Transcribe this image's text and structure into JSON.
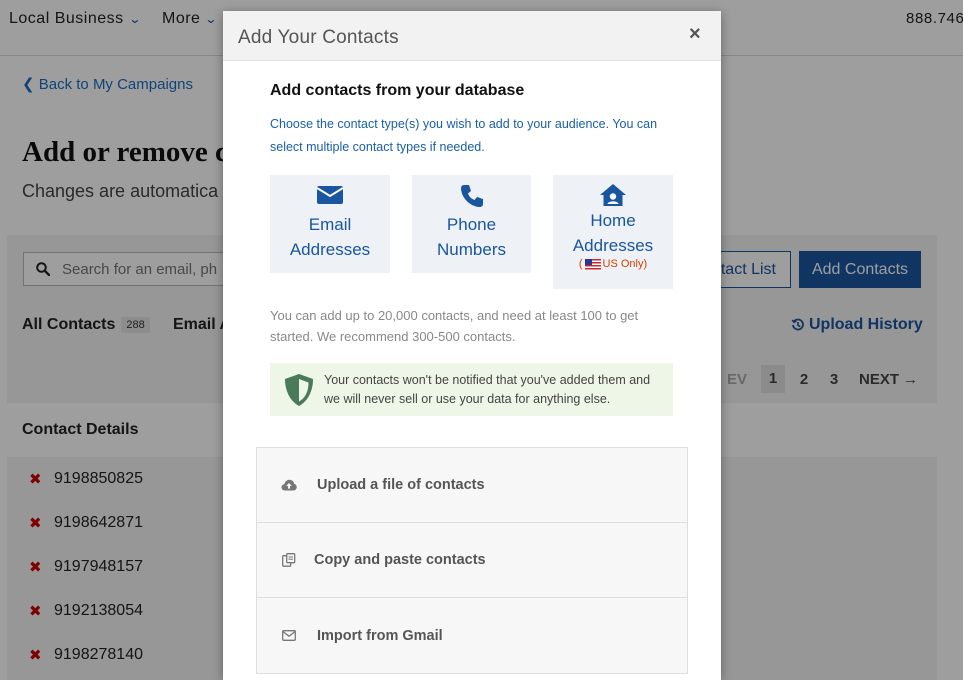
{
  "topnav": {
    "local_business": "Local Business",
    "more": "More",
    "phone": "888.746"
  },
  "page": {
    "back_link": "Back to My Campaigns",
    "title": "Add or remove c",
    "subtitle": "Changes are automatica"
  },
  "toolbar": {
    "search_placeholder": "Search for an email, ph",
    "contact_list_label": "tact List",
    "add_contacts_label": "Add Contacts",
    "filter_all_label": "All Contacts",
    "filter_all_count": "288",
    "filter_email_label": "Email A",
    "upload_history_label": "Upload History"
  },
  "pagination": {
    "prev_label": "EV",
    "pages": [
      "1",
      "2",
      "3"
    ],
    "current": "1",
    "next_label": "NEXT"
  },
  "contacts": {
    "header": "Contact Details",
    "rows": [
      "9198850825",
      "9198642871",
      "9197948157",
      "9192138054",
      "9198278140"
    ]
  },
  "modal": {
    "title": "Add Your Contacts",
    "close_label": "×",
    "section_heading": "Add contacts from your database",
    "instructions": "Choose the contact type(s) you wish to add to your audience. You can select multiple contact types if needed.",
    "types": [
      {
        "label_line1": "Email",
        "label_line2": "Addresses",
        "icon": "envelope-icon"
      },
      {
        "label_line1": "Phone",
        "label_line2": "Numbers",
        "icon": "phone-icon"
      },
      {
        "label_line1": "Home",
        "label_line2": "Addresses",
        "icon": "home-icon",
        "note_open": "(",
        "note": "US Only)"
      }
    ],
    "limits_text": "You can add up to 20,000 contacts, and need at least 100 to get started. We recommend 300-500 contacts.",
    "privacy_text": "Your contacts won't be notified that you've added them and we will never sell or use your data for anything else.",
    "options": [
      {
        "label": "Upload a file of contacts",
        "icon": "cloud-upload-icon"
      },
      {
        "label": "Copy and paste contacts",
        "icon": "copy-icon"
      },
      {
        "label": "Import from Gmail",
        "icon": "envelope-outline-icon"
      }
    ]
  },
  "colors": {
    "brand_blue": "#1a56a0",
    "link_blue": "#1a6fc2",
    "remove_red": "#cc0000",
    "privacy_green": "#eef6e7",
    "us_only_orange": "#d44000"
  }
}
